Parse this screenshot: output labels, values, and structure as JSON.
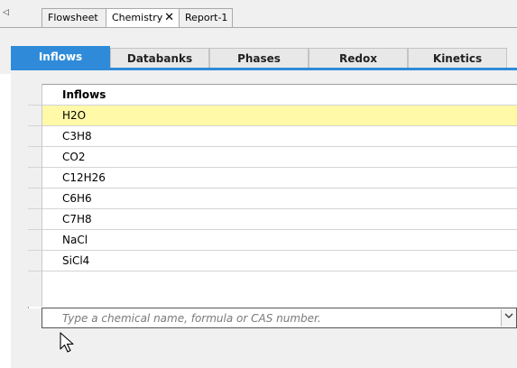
{
  "document_tabs": {
    "scroll_icon": "◁",
    "tabs": [
      {
        "label": "Flowsheet",
        "active": false,
        "closable": false
      },
      {
        "label": "Chemistry",
        "active": true,
        "closable": true,
        "close_icon": "✕"
      },
      {
        "label": "Report-1",
        "active": false,
        "closable": false
      }
    ]
  },
  "chemistry_tabs": [
    "Inflows",
    "Databanks",
    "Phases",
    "Redox",
    "Kinetics"
  ],
  "active_chemistry_tab": "Inflows",
  "grid": {
    "header": "Inflows",
    "rows": [
      "H2O",
      "C3H8",
      "CO2",
      "C12H26",
      "C6H6",
      "C7H8",
      "NaCl",
      "SiCl4"
    ],
    "selected_row": "H2O"
  },
  "entry": {
    "placeholder": "Type a chemical name, formula or CAS number.",
    "value": "",
    "dropdown_icon": "chevron-down-icon"
  },
  "colors": {
    "accent": "#2f8bd9",
    "selected_row": "#fff9a8"
  }
}
